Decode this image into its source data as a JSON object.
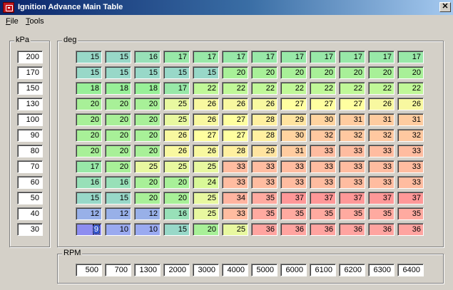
{
  "window": {
    "title": "Ignition Advance Main Table",
    "close_glyph": "✕"
  },
  "menu": [
    {
      "label": "File",
      "accel": "F",
      "rest": "ile"
    },
    {
      "label": "Tools",
      "accel": "T",
      "rest": "ools"
    }
  ],
  "kpa": {
    "label": "kPa",
    "values": [
      "200",
      "170",
      "150",
      "130",
      "100",
      "90",
      "80",
      "70",
      "60",
      "50",
      "40",
      "30"
    ]
  },
  "table": {
    "label": "deg",
    "selected": {
      "row": 11,
      "col": 0
    },
    "rows": [
      [
        "15",
        "15",
        "16",
        "17",
        "17",
        "17",
        "17",
        "17",
        "17",
        "17",
        "17",
        "17"
      ],
      [
        "15",
        "15",
        "15",
        "15",
        "15",
        "20",
        "20",
        "20",
        "20",
        "20",
        "20",
        "20"
      ],
      [
        "18",
        "18",
        "18",
        "17",
        "22",
        "22",
        "22",
        "22",
        "22",
        "22",
        "22",
        "22"
      ],
      [
        "20",
        "20",
        "20",
        "25",
        "26",
        "26",
        "26",
        "27",
        "27",
        "27",
        "26",
        "26"
      ],
      [
        "20",
        "20",
        "20",
        "25",
        "26",
        "27",
        "28",
        "29",
        "30",
        "31",
        "31",
        "31"
      ],
      [
        "20",
        "20",
        "20",
        "26",
        "27",
        "27",
        "28",
        "30",
        "32",
        "32",
        "32",
        "32"
      ],
      [
        "20",
        "20",
        "20",
        "26",
        "26",
        "28",
        "29",
        "31",
        "33",
        "33",
        "33",
        "33"
      ],
      [
        "17",
        "20",
        "25",
        "25",
        "25",
        "33",
        "33",
        "33",
        "33",
        "33",
        "33",
        "33"
      ],
      [
        "16",
        "16",
        "20",
        "20",
        "24",
        "33",
        "33",
        "33",
        "33",
        "33",
        "33",
        "33"
      ],
      [
        "15",
        "15",
        "20",
        "20",
        "25",
        "34",
        "35",
        "37",
        "37",
        "37",
        "37",
        "37"
      ],
      [
        "12",
        "12",
        "12",
        "16",
        "25",
        "33",
        "35",
        "35",
        "35",
        "35",
        "35",
        "35"
      ],
      [
        "9",
        "10",
        "10",
        "15",
        "20",
        "25",
        "36",
        "36",
        "36",
        "36",
        "36",
        "36"
      ]
    ]
  },
  "rpm": {
    "label": "RPM",
    "values": [
      "500",
      "700",
      "1300",
      "2000",
      "3000",
      "4000",
      "5000",
      "6000",
      "6100",
      "6200",
      "6300",
      "6400"
    ]
  },
  "colors": {
    "v9": "#8d8df0",
    "v10": "#9aaaf0",
    "v12": "#98b0e8",
    "v15": "#98d8c8",
    "v16": "#98e0b8",
    "v17": "#98e8a8",
    "v18": "#98f098",
    "v20": "#a8f098",
    "v22": "#c0f898",
    "v24": "#d8f898",
    "v25": "#e8f8a0",
    "v26": "#f8f8a0",
    "v27": "#ffffa0",
    "v28": "#fff0a0",
    "v29": "#ffe4a0",
    "v30": "#ffd4a0",
    "v31": "#ffcca0",
    "v32": "#ffc8a0",
    "v33": "#ffbca0",
    "v34": "#ffb4a0",
    "v35": "#ffaaa0",
    "v36": "#ffa4a0",
    "v37": "#ff9898"
  }
}
